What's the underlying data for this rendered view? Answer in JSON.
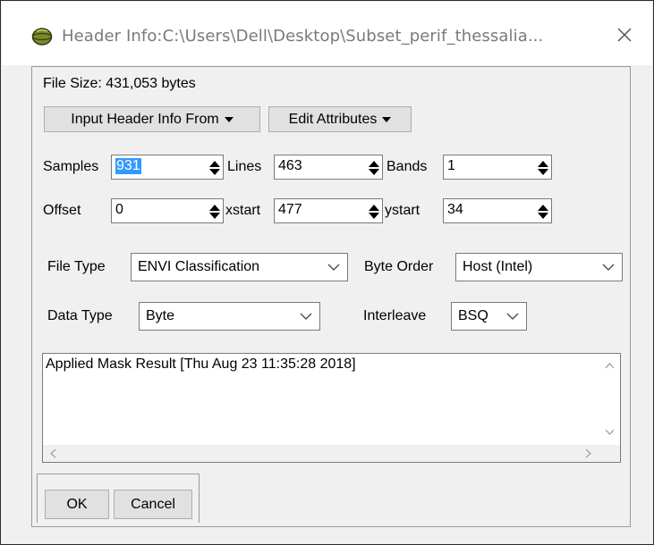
{
  "window": {
    "title": "Header Info:C:\\Users\\Dell\\Desktop\\Subset_perif_thessalia..."
  },
  "file_size": "File Size: 431,053 bytes",
  "menus": {
    "input_header": "Input Header Info From",
    "edit_attributes": "Edit Attributes"
  },
  "fields": {
    "samples": {
      "label": "Samples",
      "value": "931"
    },
    "lines": {
      "label": "Lines",
      "value": "463"
    },
    "bands": {
      "label": "Bands",
      "value": "1"
    },
    "offset": {
      "label": "Offset",
      "value": "0"
    },
    "xstart": {
      "label": "xstart",
      "value": "477"
    },
    "ystart": {
      "label": "ystart",
      "value": "34"
    }
  },
  "selects": {
    "file_type": {
      "label": "File Type",
      "value": "ENVI Classification"
    },
    "byte_order": {
      "label": "Byte Order",
      "value": "Host (Intel)"
    },
    "data_type": {
      "label": "Data Type",
      "value": "Byte"
    },
    "interleave": {
      "label": "Interleave",
      "value": "BSQ"
    }
  },
  "description": "Applied Mask Result [Thu Aug 23 11:35:28 2018]",
  "buttons": {
    "ok": "OK",
    "cancel": "Cancel"
  },
  "icons": [
    "app-globe-icon",
    "close-icon",
    "spin-arrows-icon",
    "chevron-down-icon",
    "dropdown-triangle-icon",
    "scroll-up-icon",
    "scroll-down-icon",
    "scroll-left-icon",
    "scroll-right-icon"
  ],
  "colors": {
    "selection": "#3399ff",
    "panel": "#f0f0f0",
    "title_text": "#7a7a7a"
  }
}
